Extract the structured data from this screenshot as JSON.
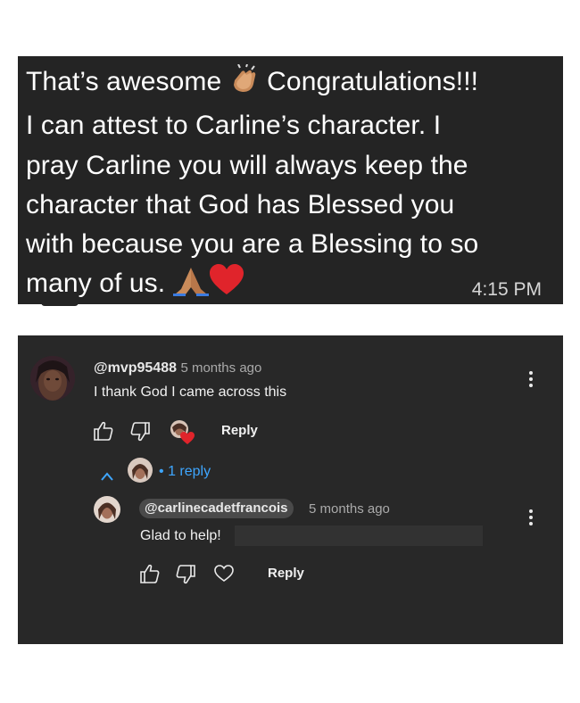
{
  "chat_message": {
    "lines": [
      "That’s awesome",
      "Congratulations!!!",
      "I can attest to  Carline’s character. I",
      "pray Carline you will always keep the",
      "character that God has Blessed you",
      "with because you are  a Blessing to so",
      "many of us."
    ],
    "time": "4:15 PM",
    "emojis": [
      "clapping-hands",
      "folded-hands",
      "red-heart"
    ]
  },
  "comment": {
    "handle": "@mvp95488",
    "age": "5 months ago",
    "text": "I thank God I came across this",
    "reply_label": "Reply",
    "replies_toggle": "1 reply",
    "colors": {
      "accent": "#3ea6ff",
      "heart": "#e0242b",
      "panel": "#282828"
    }
  },
  "reply": {
    "handle": "@carlinecadetfrancois",
    "age": "5 months ago",
    "text": "Glad to help!",
    "reply_label": "Reply"
  }
}
